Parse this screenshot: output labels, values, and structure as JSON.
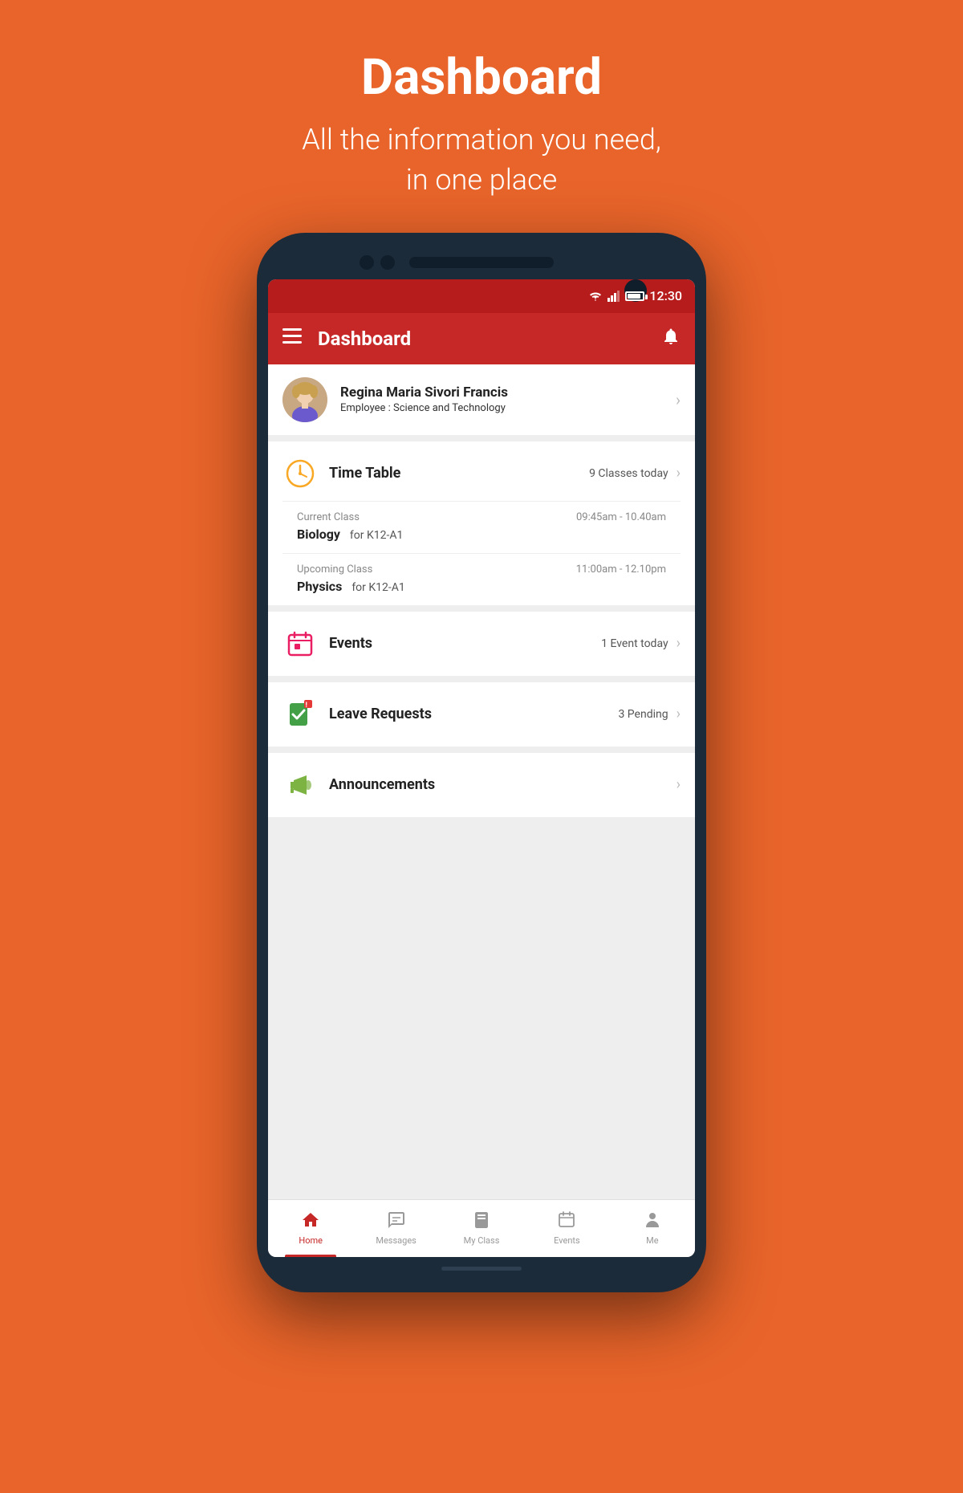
{
  "hero": {
    "title": "Dashboard",
    "subtitle_line1": "All the information you need,",
    "subtitle_line2": "in one place"
  },
  "status_bar": {
    "time": "12:30"
  },
  "app_bar": {
    "title": "Dashboard",
    "hamburger_label": "≡",
    "bell_label": "🔔"
  },
  "profile": {
    "name": "Regina Maria Sivori Francis",
    "role_label": "Employee : ",
    "role_value": "Science and Technology"
  },
  "timetable": {
    "title": "Time Table",
    "badge": "9 Classes today",
    "current_class": {
      "label": "Current Class",
      "time": "09:45am - 10.40am",
      "subject": "Biology",
      "group": "for K12-A1"
    },
    "upcoming_class": {
      "label": "Upcoming Class",
      "time": "11:00am - 12.10pm",
      "subject": "Physics",
      "group": "for K12-A1"
    }
  },
  "events": {
    "title": "Events",
    "badge": "1 Event today"
  },
  "leave_requests": {
    "title": "Leave Requests",
    "badge": "3 Pending"
  },
  "announcements": {
    "title": "Announcements"
  },
  "bottom_nav": {
    "items": [
      {
        "id": "home",
        "label": "Home",
        "active": true
      },
      {
        "id": "messages",
        "label": "Messages",
        "active": false
      },
      {
        "id": "myclass",
        "label": "My Class",
        "active": false
      },
      {
        "id": "events",
        "label": "Events",
        "active": false
      },
      {
        "id": "me",
        "label": "Me",
        "active": false
      }
    ]
  },
  "colors": {
    "primary": "#C62828",
    "accent": "#E8642A",
    "timetable_icon": "#F9A825",
    "events_icon": "#E91E63",
    "leave_icon": "#43A047",
    "announcement_icon": "#7CB342"
  }
}
